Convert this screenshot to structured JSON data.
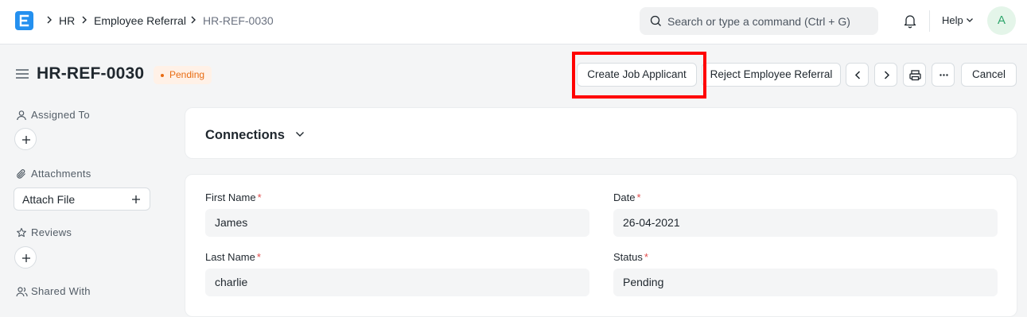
{
  "navbar": {
    "breadcrumbs": [
      "HR",
      "Employee Referral",
      "HR-REF-0030"
    ],
    "search_placeholder": "Search or type a command (Ctrl + G)",
    "help_label": "Help",
    "avatar_letter": "A"
  },
  "page": {
    "title": "HR-REF-0030",
    "status": "Pending",
    "actions": {
      "create_job_applicant": "Create Job Applicant",
      "reject_referral": "Reject Employee Referral",
      "cancel": "Cancel"
    }
  },
  "sidebar": {
    "assigned_to": "Assigned To",
    "attachments": "Attachments",
    "attach_file": "Attach File",
    "reviews": "Reviews",
    "shared_with": "Shared With"
  },
  "connections": {
    "title": "Connections"
  },
  "form": {
    "first_name": {
      "label": "First Name",
      "value": "James"
    },
    "date": {
      "label": "Date",
      "value": "26-04-2021"
    },
    "last_name": {
      "label": "Last Name",
      "value": "charlie"
    },
    "status": {
      "label": "Status",
      "value": "Pending"
    }
  },
  "colors": {
    "brand": "#2490ef",
    "status_pending": "#e86c13",
    "required": "#e24c4c",
    "highlight": "#ff0000"
  }
}
